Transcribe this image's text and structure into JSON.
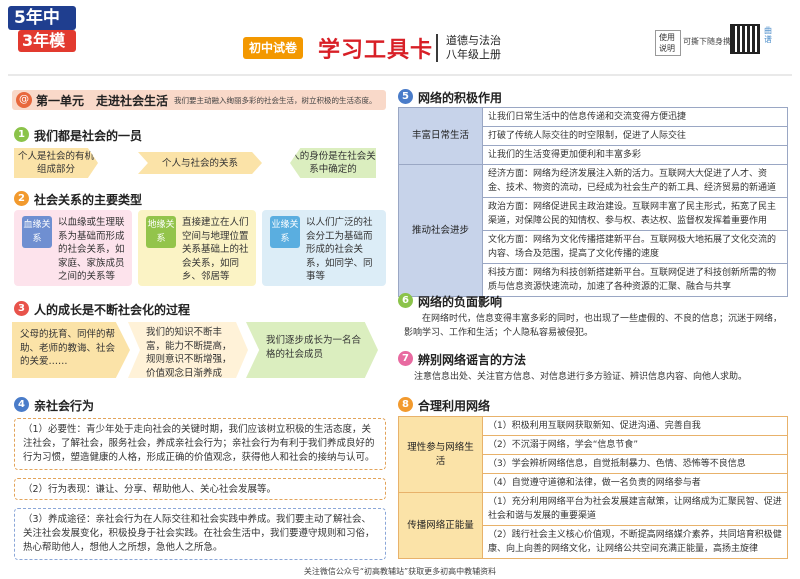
{
  "header": {
    "logo_line1": "5年中考",
    "logo_line2": "3年模拟",
    "tag": "初中试卷",
    "title": "学习工具卡",
    "subject": "道德与法治",
    "grade": "八年级上册",
    "qr_label": "使用说明",
    "qr_text": "可撕下随身携带",
    "qr_side": "曲谱"
  },
  "unit": {
    "icon": "@",
    "title": "第一单元　走进社会生活",
    "desc": "我们要主动融入绚丽多彩的社会生活，树立积极的生活态度。"
  },
  "sections": {
    "s1": {
      "num": "1",
      "title": "我们都是社会的一员",
      "items": [
        "个人是社会的有机组成部分",
        "个人与社会的关系",
        "人的身份是在社会关系中确定的"
      ]
    },
    "s2": {
      "num": "2",
      "title": "社会关系的主要类型",
      "cards": [
        {
          "tag": "血缘关系",
          "text": "以血缘或生理联系为基础而形成的社会关系，如家庭、家族成员之间的关系等"
        },
        {
          "tag": "地缘关系",
          "text": "直接建立在人们空间与地理位置关系基础上的社会关系，如同乡、邻居等"
        },
        {
          "tag": "业缘关系",
          "text": "以人们广泛的社会分工为基础而形成的社会关系，如同学、同事等"
        }
      ]
    },
    "s3": {
      "num": "3",
      "title": "人的成长是不断社会化的过程",
      "a": "父母的抚育、同伴的帮助、老师的教诲、社会的关爱……",
      "b": "我们的知识不断丰富，能力不断提高，规则意识不断增强，价值观念日渐养成",
      "c": "我们逐步成长为一名合格的社会成员"
    },
    "s4": {
      "num": "4",
      "title": "亲社会行为",
      "p1": "（1）必要性：青少年处于走向社会的关键时期，我们应该树立积极的生活态度，关注社会，了解社会，服务社会，养成亲社会行为；亲社会行为有利于我们养成良好的行为习惯，塑造健康的人格，形成正确的价值观念，获得他人和社会的接纳与认可。",
      "p2": "（2）行为表现：谦让、分享、帮助他人、关心社会发展等。",
      "p3": "（3）养成途径：亲社会行为在人际交往和社会实践中养成。我们要主动了解社会、关注社会发展变化，积极投身于社会实践。在社会生活中，我们要遵守规则和习俗，热心帮助他人，想他人之所想，急他人之所急。"
    },
    "s5": {
      "num": "5",
      "title": "网络的积极作用",
      "rows": [
        {
          "label": "丰富日常生活",
          "items": [
            "让我们日常生活中的信息传递和交流变得方便迅捷",
            "打破了传统人际交往的时空限制，促进了人际交往",
            "让我们的生活变得更加便利和丰富多彩"
          ]
        },
        {
          "label": "推动社会进步",
          "items": [
            "经济方面：网络为经济发展注入新的活力。互联网大大促进了人才、资金、技术、物资的流动，已经成为社会生产的新工具、经济贸易的新通道",
            "政治方面：网络促进民主政治建设。互联网丰富了民主形式，拓宽了民主渠道，对保障公民的知情权、参与权、表达权、监督权发挥着重要作用",
            "文化方面：网络为文化传播搭建新平台。互联网极大地拓展了文化交流的内容、场合及范围，提高了文化传播的速度",
            "科技方面：网络为科技创新搭建新平台。互联网促进了科技创新所需的物质与信息资源快速流动，加速了各种资源的汇聚、融合与共享"
          ]
        }
      ]
    },
    "s6": {
      "num": "6",
      "title": "网络的负面影响",
      "text": "在网络时代，信息变得丰富多彩的同时，也出现了一些虚假的、不良的信息；沉迷于网络，影响学习、工作和生活；个人隐私容易被侵犯。"
    },
    "s7": {
      "num": "7",
      "title": "辨别网络谣言的方法",
      "text": "注意信息出处、关注官方信息、对信息进行多方验证、辨识信息内容、向他人求助。"
    },
    "s8": {
      "num": "8",
      "title": "合理利用网络",
      "rows": [
        {
          "label": "理性参与网络生活",
          "items": [
            "（1）积极利用互联网获取新知、促进沟通、完善自我",
            "（2）不沉溺于网络，学会“信息节食”",
            "（3）学会辨析网络信息，自觉抵制暴力、色情、恐怖等不良信息",
            "（4）自觉遵守道德和法律，做一名负责的网络参与者"
          ]
        },
        {
          "label": "传播网络正能量",
          "items": [
            "（1）充分利用网络平台为社会发展建言献策，让网络成为汇聚民智、促进社会和谐与发展的重要渠道",
            "（2）践行社会主义核心价值观，不断提高网络媒介素养，共同培育积极健康、向上向善的网络文化，让网络公共空间充满正能量，高扬主旋律"
          ]
        }
      ]
    }
  },
  "footer": "关注微信公众号“初高教辅站”获取更多初高中教辅资料",
  "colors": {
    "title_red": "#d81f26",
    "orange": "#f39800",
    "table_blue": "#c7d3ea",
    "table_orange": "#fbe3a8"
  }
}
